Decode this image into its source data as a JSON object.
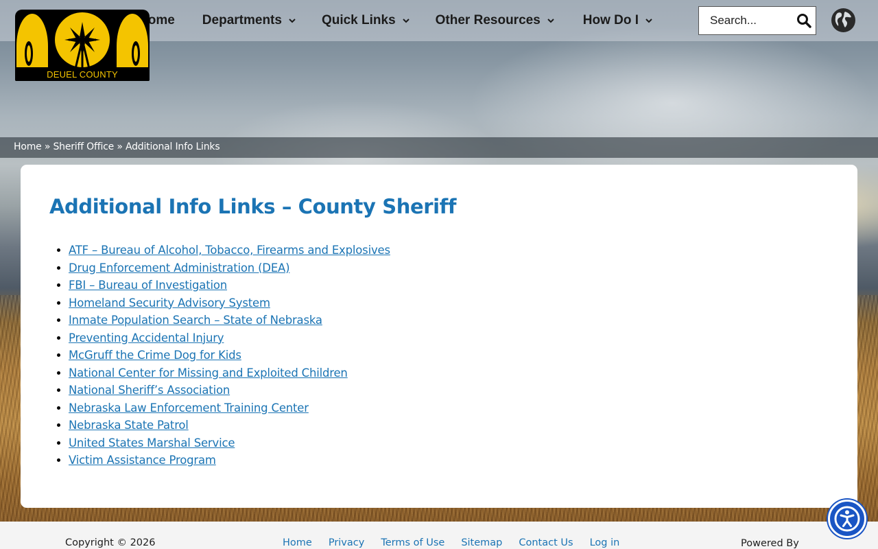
{
  "site": {
    "logo_text": "DEUEL COUNTY"
  },
  "nav": {
    "items": [
      {
        "label": "Home",
        "has_dropdown": false
      },
      {
        "label": "Departments",
        "has_dropdown": true
      },
      {
        "label": "Quick Links",
        "has_dropdown": true
      },
      {
        "label": "Other Resources",
        "has_dropdown": true
      },
      {
        "label": "How Do I",
        "has_dropdown": true
      }
    ]
  },
  "search": {
    "placeholder": "Search...",
    "icon": "search-icon"
  },
  "language": {
    "icon": "globe-icon"
  },
  "breadcrumb": {
    "items": [
      "Home",
      "Sheriff Office",
      "Additional Info Links"
    ],
    "separator": "»"
  },
  "main": {
    "title": "Additional Info Links – County Sheriff",
    "links": [
      "ATF – Bureau of Alcohol, Tobacco, Firearms and Explosives",
      "Drug Enforcement Administration (DEA)",
      "FBI – Bureau of Investigation",
      "Homeland Security Advisory System",
      "Inmate Population Search – State of Nebraska",
      "Preventing Accidental Injury",
      "McGruff the Crime Dog for Kids",
      "National Center for Missing and Exploited Children",
      "National Sheriff’s Association",
      "Nebraska Law Enforcement Training Center",
      "Nebraska State Patrol",
      "United States Marshal Service",
      "Victim Assistance Program"
    ]
  },
  "footer": {
    "copyright": "Copyright © 2026",
    "links": [
      "Home",
      "Privacy",
      "Terms of Use",
      "Sitemap",
      "Contact Us",
      "Log in"
    ],
    "powered_by": "Powered By"
  },
  "accessibility": {
    "icon": "accessibility-icon"
  },
  "colors": {
    "accent": "#1b74b4",
    "logo_gold": "#f4c400",
    "a11y_blue": "#1a55c4"
  }
}
